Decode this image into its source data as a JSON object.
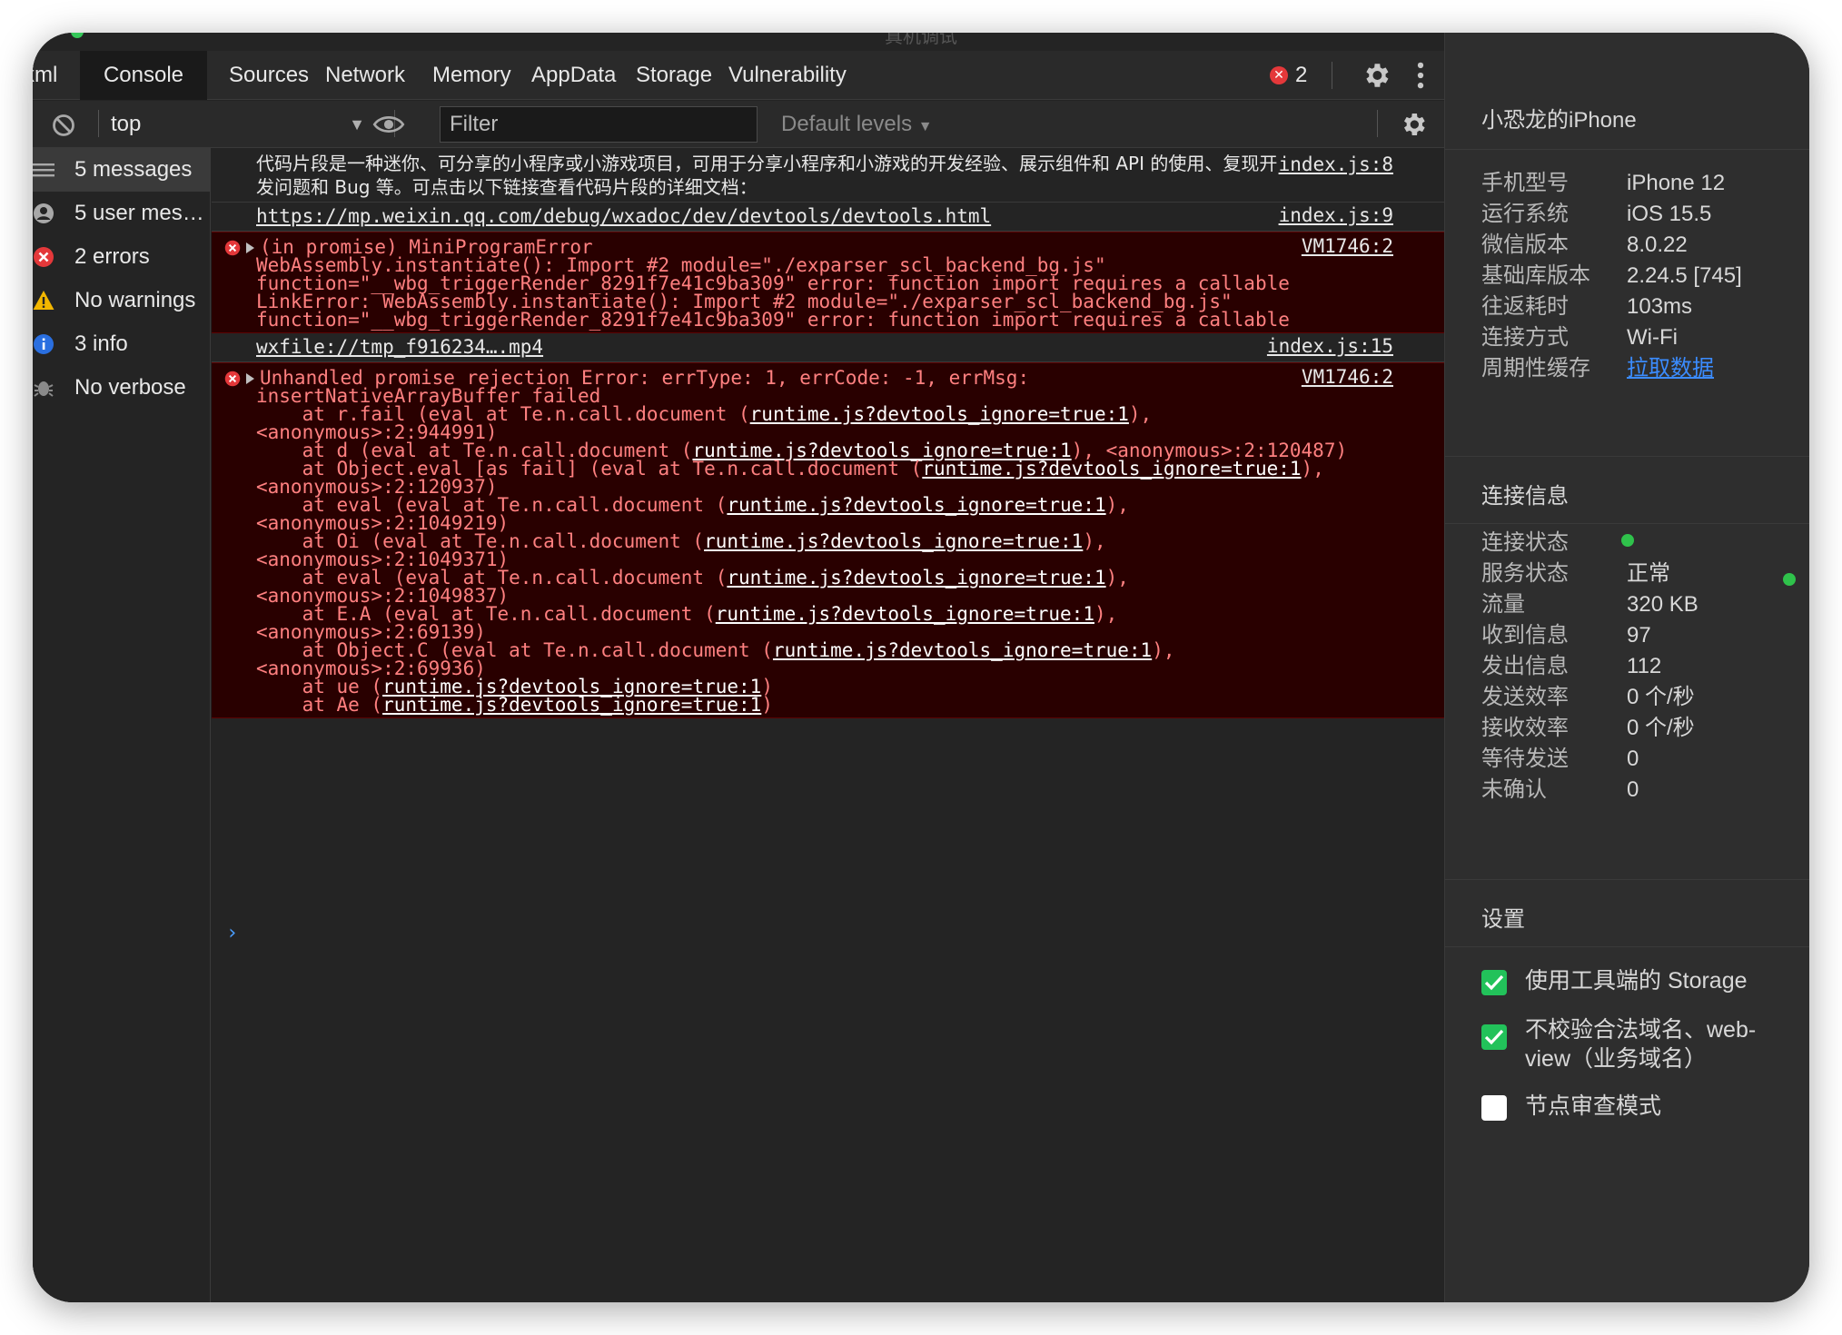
{
  "window": {
    "title": "真机调试"
  },
  "tabs": [
    {
      "label": "xml",
      "active": false
    },
    {
      "label": "Console",
      "active": true
    },
    {
      "label": "Sources",
      "active": false
    },
    {
      "label": "Network",
      "active": false
    },
    {
      "label": "Memory",
      "active": false
    },
    {
      "label": "AppData",
      "active": false
    },
    {
      "label": "Storage",
      "active": false
    },
    {
      "label": "Vulnerability",
      "active": false
    }
  ],
  "error_badge": {
    "count": "2"
  },
  "toolbar": {
    "context": "top",
    "filter_placeholder": "Filter",
    "levels": "Default levels"
  },
  "sidebar": {
    "items": [
      {
        "label": "5 messages",
        "icon": "list-icon",
        "active": true
      },
      {
        "label": "5 user messages",
        "icon": "user-icon",
        "active": false
      },
      {
        "label": "2 errors",
        "icon": "error-icon",
        "active": false
      },
      {
        "label": "No warnings",
        "icon": "warning-icon",
        "active": false
      },
      {
        "label": "3 info",
        "icon": "info-icon",
        "active": false
      },
      {
        "label": "No verbose",
        "icon": "bug-icon",
        "active": false
      }
    ]
  },
  "console": {
    "messages": [
      {
        "type": "log",
        "text": "代码片段是一种迷你、可分享的小程序或小游戏项目，可用于分享小程序和小游戏的开发经验、展示组件和 API 的使用、复现开发问题和 Bug 等。可点击以下链接查看代码片段的详细文档：",
        "source": "index.js:8"
      },
      {
        "type": "log",
        "text": "https://mp.weixin.qq.com/debug/wxadoc/dev/devtools/devtools.html",
        "source": "index.js:9"
      },
      {
        "type": "error",
        "lines": [
          "(in promise) MiniProgramError",
          "WebAssembly.instantiate(): Import #2 module=\"./exparser_scl_backend_bg.js\"",
          "function=\"__wbg_triggerRender_8291f7e41c9ba309\" error: function import requires a callable",
          "LinkError: WebAssembly.instantiate(): Import #2 module=\"./exparser_scl_backend_bg.js\"",
          "function=\"__wbg_triggerRender_8291f7e41c9ba309\" error: function import requires a callable"
        ],
        "source": "VM1746:2"
      },
      {
        "type": "log",
        "text": "wxfile://tmp_f916234….mp4",
        "source": "index.js:15"
      },
      {
        "type": "error",
        "head": "Unhandled promise rejection Error: errType: 1, errCode: -1, errMsg:",
        "head2": "insertNativeArrayBuffer failed",
        "link": "runtime.js?devtools_ignore=true:1",
        "frames": [
          {
            "pre": "    at r.fail (eval at Te.n.call.document (",
            "post": "),",
            "cont": "<anonymous>:2:944991)"
          },
          {
            "pre": "    at d (eval at Te.n.call.document (",
            "post": "), <anonymous>:2:120487)",
            "cont": ""
          },
          {
            "pre": "    at Object.eval [as fail] (eval at Te.n.call.document (",
            "post": "),",
            "cont": "<anonymous>:2:120937)"
          },
          {
            "pre": "    at eval (eval at Te.n.call.document (",
            "post": "),",
            "cont": "<anonymous>:2:1049219)"
          },
          {
            "pre": "    at Oi (eval at Te.n.call.document (",
            "post": "),",
            "cont": "<anonymous>:2:1049371)"
          },
          {
            "pre": "    at eval (eval at Te.n.call.document (",
            "post": "),",
            "cont": "<anonymous>:2:1049837)"
          },
          {
            "pre": "    at E.A (eval at Te.n.call.document (",
            "post": "),",
            "cont": "<anonymous>:2:69139)"
          },
          {
            "pre": "    at Object.C (eval at Te.n.call.document (",
            "post": "),",
            "cont": "<anonymous>:2:69936)"
          },
          {
            "pre": "    at ue (",
            "post": ")",
            "cont": ""
          },
          {
            "pre": "    at Ae (",
            "post": ")",
            "cont": ""
          }
        ],
        "source": "VM1746:2"
      }
    ],
    "prompt": "›"
  },
  "info": {
    "device_name": "小恐龙的iPhone",
    "device_rows": [
      {
        "key": "手机型号",
        "value": "iPhone 12"
      },
      {
        "key": "运行系统",
        "value": "iOS 15.5"
      },
      {
        "key": "微信版本",
        "value": "8.0.22"
      },
      {
        "key": "基础库版本",
        "value": "2.24.5 [745]"
      },
      {
        "key": "往返耗时",
        "value": "103ms"
      },
      {
        "key": "连接方式",
        "value": "Wi-Fi"
      },
      {
        "key": "周期性缓存",
        "value": "拉取数据",
        "link": true
      }
    ],
    "conn_title": "连接信息",
    "conn_rows": [
      {
        "key": "连接状态",
        "value": ""
      },
      {
        "key": "服务状态",
        "value": "正常"
      },
      {
        "key": "流量",
        "value": "320 KB"
      },
      {
        "key": "收到信息",
        "value": "97"
      },
      {
        "key": "发出信息",
        "value": "112"
      },
      {
        "key": "发送效率",
        "value": "0 个/秒"
      },
      {
        "key": "接收效率",
        "value": "0 个/秒"
      },
      {
        "key": "等待发送",
        "value": "0"
      },
      {
        "key": "未确认",
        "value": "0"
      }
    ],
    "settings_title": "设置",
    "settings": [
      {
        "label": "使用工具端的 Storage",
        "checked": true
      },
      {
        "label": "不校验合法域名、web-view（业务域名）",
        "checked": true
      },
      {
        "label": "节点审查模式",
        "checked": false
      }
    ],
    "colors": {
      "ok": "#2fc24b",
      "link": "#3b8cff",
      "check": "#22c25a"
    }
  }
}
